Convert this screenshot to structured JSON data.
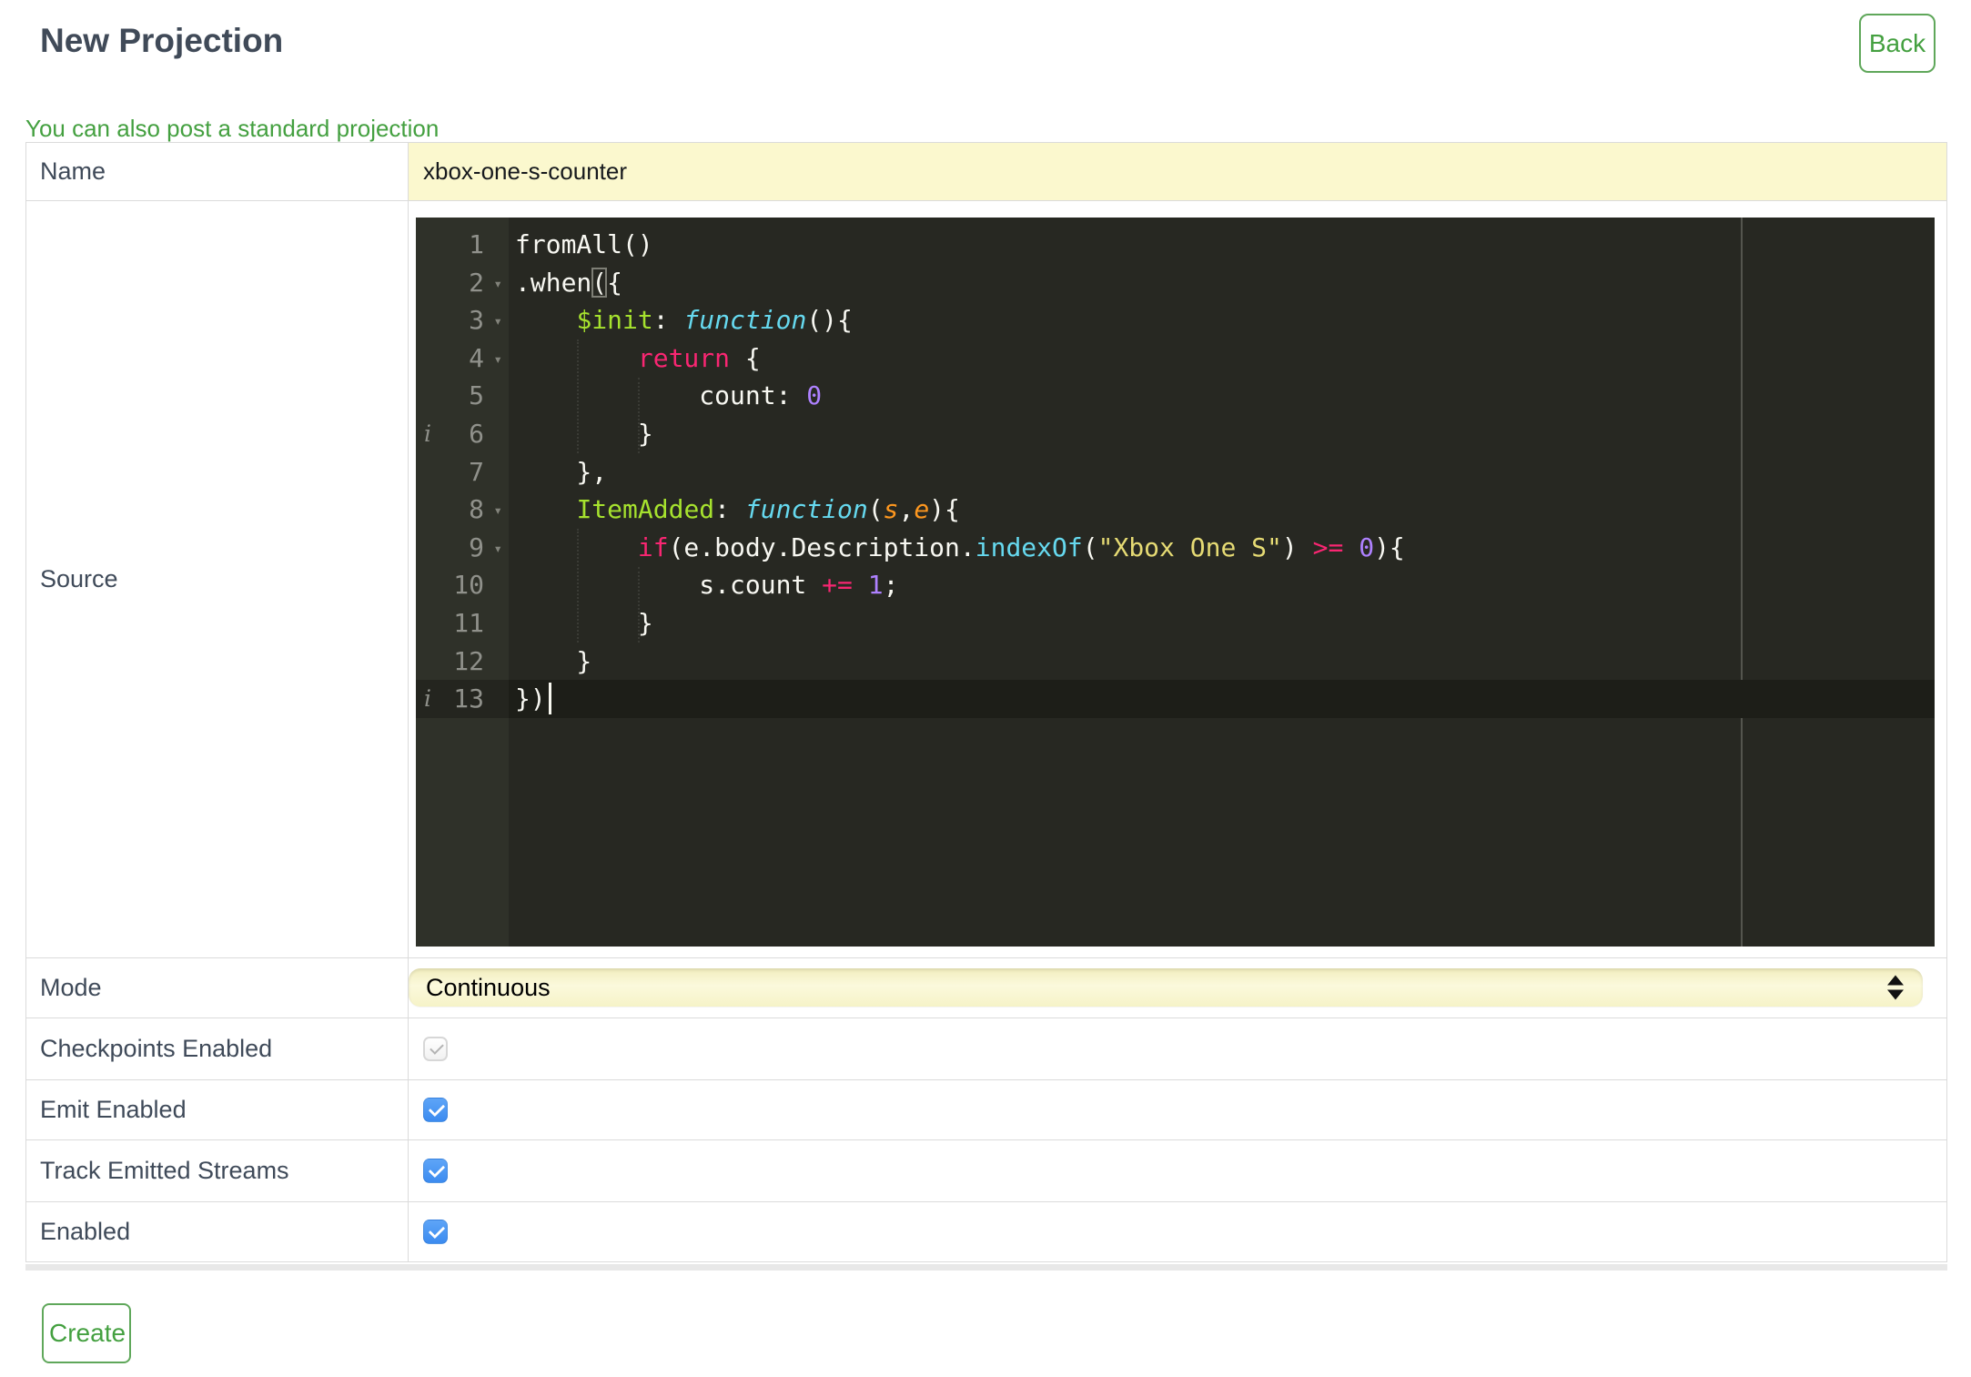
{
  "page": {
    "title": "New Projection",
    "back_label": "Back",
    "standard_link": "You can also post a standard projection",
    "create_label": "Create"
  },
  "form": {
    "name": {
      "label": "Name",
      "value": "xbox-one-s-counter"
    },
    "source": {
      "label": "Source"
    },
    "mode": {
      "label": "Mode",
      "value": "Continuous"
    },
    "checkpoints": {
      "label": "Checkpoints Enabled",
      "checked": true,
      "disabled": true
    },
    "emit": {
      "label": "Emit Enabled",
      "checked": true,
      "disabled": false
    },
    "track": {
      "label": "Track Emitted Streams",
      "checked": true,
      "disabled": false
    },
    "enabled": {
      "label": "Enabled",
      "checked": true,
      "disabled": false
    }
  },
  "editor": {
    "fold_icon_glyph": "▾",
    "info_icon_glyph": "i",
    "lines": [
      {
        "n": 1,
        "fold": false,
        "info": false,
        "active": false,
        "tokens": [
          [
            "p",
            "fromAll()"
          ]
        ]
      },
      {
        "n": 2,
        "fold": true,
        "info": false,
        "active": false,
        "tokens": [
          [
            "p",
            ".when"
          ],
          [
            "bm",
            "("
          ],
          [
            "p",
            "{"
          ]
        ]
      },
      {
        "n": 3,
        "fold": true,
        "info": false,
        "active": false,
        "tokens": [
          [
            "p",
            "    "
          ],
          [
            "n",
            "$init"
          ],
          [
            "p",
            ": "
          ],
          [
            "f",
            "function"
          ],
          [
            "p",
            "(){"
          ]
        ]
      },
      {
        "n": 4,
        "fold": true,
        "info": false,
        "active": false,
        "tokens": [
          [
            "p",
            "        "
          ],
          [
            "k",
            "return"
          ],
          [
            "p",
            " {"
          ]
        ]
      },
      {
        "n": 5,
        "fold": false,
        "info": false,
        "active": false,
        "tokens": [
          [
            "p",
            "            count: "
          ],
          [
            "d",
            "0"
          ]
        ]
      },
      {
        "n": 6,
        "fold": false,
        "info": true,
        "active": false,
        "tokens": [
          [
            "p",
            "        }"
          ]
        ]
      },
      {
        "n": 7,
        "fold": false,
        "info": false,
        "active": false,
        "tokens": [
          [
            "p",
            "    },"
          ]
        ]
      },
      {
        "n": 8,
        "fold": true,
        "info": false,
        "active": false,
        "tokens": [
          [
            "p",
            "    "
          ],
          [
            "n",
            "ItemAdded"
          ],
          [
            "p",
            ": "
          ],
          [
            "f",
            "function"
          ],
          [
            "p",
            "("
          ],
          [
            "a",
            "s"
          ],
          [
            "p",
            ","
          ],
          [
            "a",
            "e"
          ],
          [
            "p",
            "){"
          ]
        ]
      },
      {
        "n": 9,
        "fold": true,
        "info": false,
        "active": false,
        "tokens": [
          [
            "p",
            "        "
          ],
          [
            "k",
            "if"
          ],
          [
            "p",
            "(e.body.Description."
          ],
          [
            "c",
            "indexOf"
          ],
          [
            "p",
            "("
          ],
          [
            "s",
            "\"Xbox One S\""
          ],
          [
            "p",
            ") "
          ],
          [
            "k",
            ">="
          ],
          [
            "p",
            " "
          ],
          [
            "d",
            "0"
          ],
          [
            "p",
            "){"
          ]
        ]
      },
      {
        "n": 10,
        "fold": false,
        "info": false,
        "active": false,
        "tokens": [
          [
            "p",
            "            s.count "
          ],
          [
            "k",
            "+="
          ],
          [
            "p",
            " "
          ],
          [
            "d",
            "1"
          ],
          [
            "p",
            ";"
          ]
        ]
      },
      {
        "n": 11,
        "fold": false,
        "info": false,
        "active": false,
        "tokens": [
          [
            "p",
            "        }"
          ]
        ]
      },
      {
        "n": 12,
        "fold": false,
        "info": false,
        "active": false,
        "tokens": [
          [
            "p",
            "    }"
          ]
        ]
      },
      {
        "n": 13,
        "fold": false,
        "info": true,
        "active": true,
        "tokens": [
          [
            "p",
            "})"
          ]
        ]
      }
    ]
  },
  "colors": {
    "accent_green": "#44A040",
    "green_border": "#5FA75A",
    "title_text": "#404A58",
    "label_text": "#3F4A59",
    "border_grey": "#DBDBDB",
    "input_yellow": "#FBF8CE",
    "select_yellow_top": "#F2EEBE",
    "select_yellow_mid": "#FBF9DC",
    "checkbox_blue_top": "#5EA5F7",
    "checkbox_blue_bottom": "#3C8BF0",
    "editor_bg": "#272822",
    "editor_gutter_bg": "#2F3129",
    "editor_gutter_text": "#90918B",
    "editor_active_line": "#1D1E18",
    "tok_plain": "#F8F8F2",
    "tok_keyword": "#F92672",
    "tok_function": "#66D9EF",
    "tok_name": "#A6E22E",
    "tok_string": "#E6DB74",
    "tok_number": "#AE81FF",
    "tok_param": "#FD971F"
  }
}
